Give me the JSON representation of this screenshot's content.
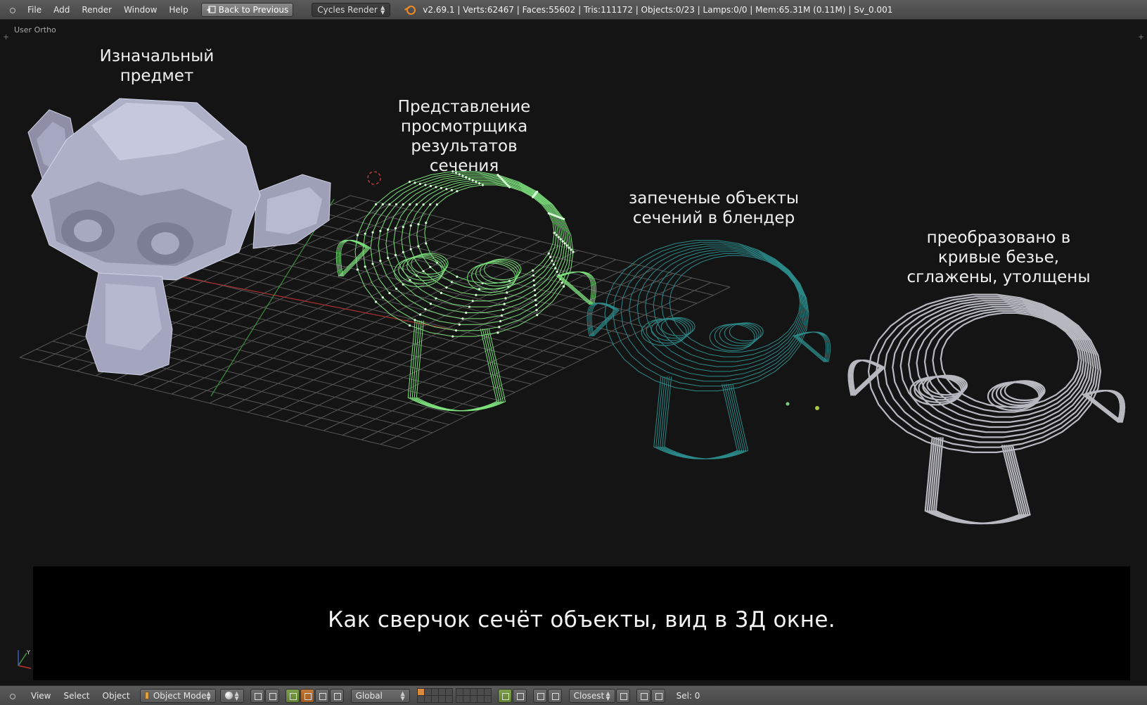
{
  "header": {
    "menus": [
      "File",
      "Add",
      "Render",
      "Window",
      "Help"
    ],
    "back_button": "Back to Previous",
    "render_engine": "Cycles Render",
    "stats": "v2.69.1 | Verts:62467 | Faces:55602 | Tris:111172 | Objects:0/23 | Lamps:0/0 | Mem:65.31M (0.11M) | Sv_0.001"
  },
  "viewport": {
    "view_label": "User Ortho",
    "annotations": {
      "original": "Изначальный\nпредмет",
      "viewer": "Представление\nпросмотрщика\nрезультатов\nсечения",
      "baked": "запеченые объекты\nсечений в блендер",
      "curves": "преобразовано в\nкривые безье,\nсглажены, утолщены"
    },
    "caption": "Как сверчок сечёт объекты, вид в 3Д окне."
  },
  "footer": {
    "menus": [
      "View",
      "Select",
      "Object"
    ],
    "mode": "Object Mode",
    "orientation": "Global",
    "snap_target": "Closest",
    "selection": "Sel: 0"
  },
  "colors": {
    "viewer_wire": "#7ee27e",
    "baked_wire": "#2c8a8a",
    "curve_wire": "#b8b8c0",
    "grid": "#5a5a5a",
    "x_axis": "#b03030",
    "y_axis": "#3a9a3a"
  },
  "icons": {
    "logo": "blender-logo-icon",
    "back": "back-arrow-icon"
  }
}
